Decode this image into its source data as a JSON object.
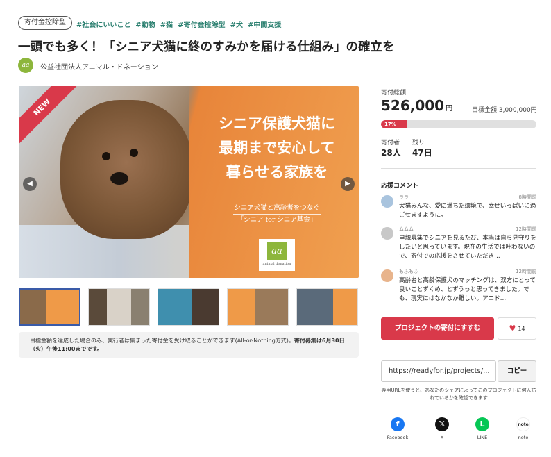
{
  "header": {
    "category_badge": "寄付金控除型",
    "tags": [
      "#社会にいいこと",
      "#動物",
      "#猫",
      "#寄付金控除型",
      "#犬",
      "#中間支援"
    ],
    "title": "一頭でも多く！「シニア犬猫に終のすみかを届ける仕組み」の確立を",
    "org_logo_text": "aa",
    "org_name": "公益社団法人アニマル・ドネーション"
  },
  "hero": {
    "ribbon": "NEW",
    "headline_lines": [
      "シニア保護犬猫に",
      "最期まで安心して",
      "暮らせる家族を"
    ],
    "sub_line1": "シニア犬猫と高齢者をつなぐ",
    "sub_line2": "「シニア for シニア基金」",
    "logo_mark": "aa",
    "logo_text": "animal donation",
    "prev_icon": "chevron-left-icon",
    "next_icon": "chevron-right-icon"
  },
  "thumbnails": [
    {
      "name": "thumb-1",
      "selected": true
    },
    {
      "name": "thumb-2",
      "selected": false
    },
    {
      "name": "thumb-3",
      "selected": false
    },
    {
      "name": "thumb-4",
      "selected": false
    },
    {
      "name": "thumb-5",
      "selected": false
    }
  ],
  "notice": {
    "text": "目標金額を達成した場合のみ、実行者は集まった寄付金を受け取ることができます(All-or-Nothing方式)。",
    "bold": "寄付募集は6月30日（火）午後11:00までです。"
  },
  "stats": {
    "total_label": "寄付総額",
    "total_value": "526,000",
    "total_unit": "円",
    "goal_text": "目標金額 3,000,000円",
    "progress_percent": 17,
    "progress_label": "17%",
    "donors_label": "寄付者",
    "donors_value": "28人",
    "remaining_label": "残り",
    "remaining_value": "47日"
  },
  "comments": {
    "title": "応援コメント",
    "items": [
      {
        "name": "ララ",
        "time": "8時間前",
        "text": "犬猫みんな、愛に満ちた環境で、幸せいっぱいに過ごせますように。",
        "avatar_color": "#a9c4de"
      },
      {
        "name": "ムムム",
        "time": "12時間前",
        "text": "里親募集でシニアを見るたび、本当は自ら見守りをしたいと思っています。現在の生活では叶わないので、寄付での応援をさせていただき…",
        "avatar_color": "#c8c8c8"
      },
      {
        "name": "もふもふ",
        "time": "12時間前",
        "text": "高齢者と高齢保護犬のマッチングは、双方にとって良いことずくめ、とずうっと思ってきました。でも、現実にはなかなか難しい。アニド…",
        "avatar_color": "#e8b48c"
      }
    ]
  },
  "actions": {
    "donate_button": "プロジェクトの寄付にすすむ",
    "like_count": "14",
    "like_icon": "heart-icon",
    "url_value": "https://readyfor.jp/projects/...",
    "copy_button": "コピー",
    "url_note": "専用URLを使うと、あなたのシェアによってこのプロジェクトに何人訪れているかを確認できます"
  },
  "share": [
    {
      "label": "Facebook",
      "icon": "facebook-icon",
      "glyph": "f",
      "color": "#1877f2"
    },
    {
      "label": "X",
      "icon": "x-icon",
      "glyph": "𝕏",
      "color": "#111111"
    },
    {
      "label": "LINE",
      "icon": "line-icon",
      "glyph": "L",
      "color": "#06c755"
    },
    {
      "label": "note",
      "icon": "note-icon",
      "glyph": "note",
      "color": "#ffffff"
    }
  ],
  "colors": {
    "accent": "#d9394a",
    "tag": "#2a7f6f",
    "orange": "#ef9a48"
  }
}
